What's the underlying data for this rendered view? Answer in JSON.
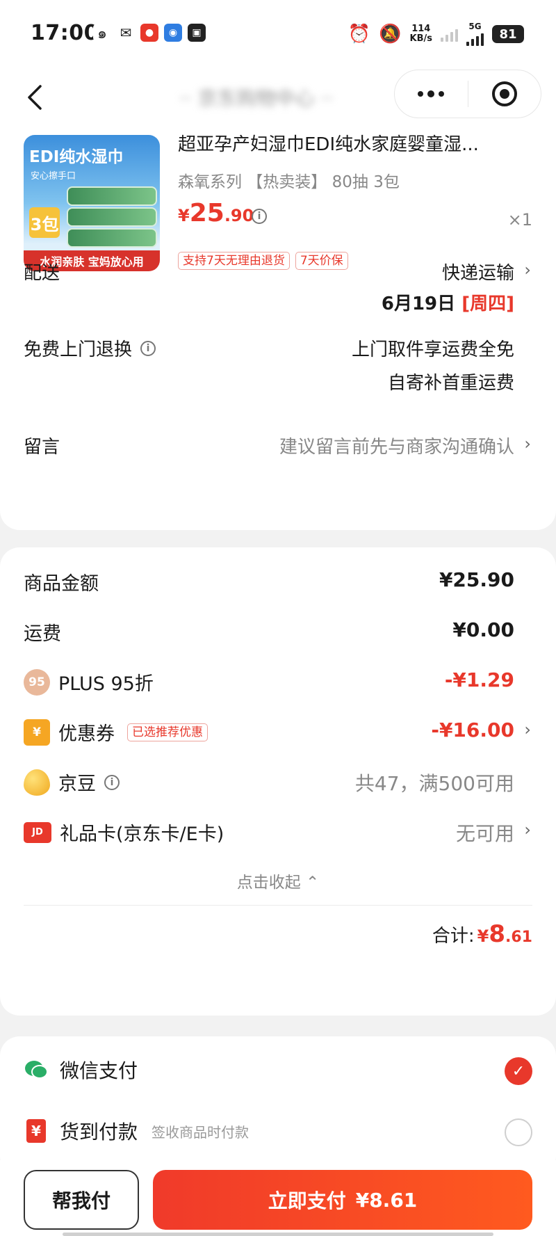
{
  "status_bar": {
    "time": "17:00",
    "net_speed_value": "114",
    "net_speed_unit": "KB/s",
    "network": "5G",
    "battery": "81"
  },
  "nav": {
    "title": "·· 京东购物中心 ··"
  },
  "product": {
    "image_title": "EDI纯水湿巾",
    "image_subtitle": "安心擦手口",
    "image_count": "3包",
    "image_banner": "水润亲肤  宝妈放心用",
    "title": "超亚孕产妇湿巾EDI纯水家庭婴童湿...",
    "spec": "森氧系列 【热卖装】 80抽 3包",
    "price_currency": "¥",
    "price_int": "25",
    "price_dec": ".90",
    "quantity": "×1",
    "tags": [
      "支持7天无理由退货",
      "7天价保"
    ]
  },
  "delivery": {
    "label": "配送",
    "method": "快递运输",
    "date": "6月19日",
    "weekday": "[周四]"
  },
  "returns": {
    "label": "免费上门退换",
    "line1": "上门取件享运费全免",
    "line2": "自寄补首重运费"
  },
  "message": {
    "label": "留言",
    "placeholder": "建议留言前先与商家沟通确认"
  },
  "pricing": {
    "goods_label": "商品金额",
    "goods_value": "¥25.90",
    "shipping_label": "运费",
    "shipping_value": "¥0.00",
    "plus_badge": "95",
    "plus_label": "PLUS 95折",
    "plus_value": "-¥1.29",
    "coupon_label": "优惠券",
    "coupon_badge": "已选推荐优惠",
    "coupon_value": "-¥16.00",
    "beans_label": "京豆",
    "beans_value": "共47，满500可用",
    "gift_label": "礼品卡(京东卡/E卡)",
    "gift_badge": "JD",
    "gift_value": "无可用",
    "collapse_label": "点击收起",
    "total_label": "合计:",
    "total_currency": "¥",
    "total_int": "8",
    "total_dec": ".61"
  },
  "payment": {
    "wechat_label": "微信支付",
    "cod_label": "货到付款",
    "cod_sub": "签收商品时付款"
  },
  "bottom": {
    "help_label": "帮我付",
    "pay_label": "立即支付",
    "pay_amount": "¥8.61"
  },
  "colors": {
    "accent": "#e8382b",
    "pay_button_start": "#f03a2a",
    "pay_button_end": "#ff5a1f",
    "wechat_green": "#2aae67",
    "coupon_yellow": "#f5a623"
  }
}
